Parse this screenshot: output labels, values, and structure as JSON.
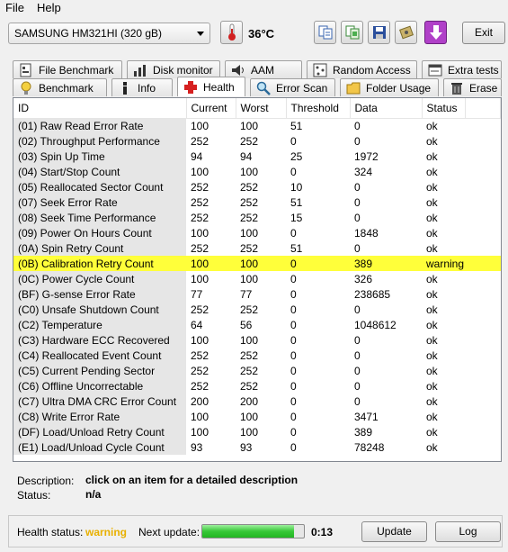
{
  "menu": {
    "file": "File",
    "help": "Help"
  },
  "toolbar": {
    "drive": "SAMSUNG HM321HI (320 gB)",
    "temperature": "36°C",
    "exit": "Exit"
  },
  "tabs_top": [
    {
      "label": "File Benchmark",
      "icon": "file-benchmark-icon"
    },
    {
      "label": "Disk monitor",
      "icon": "disk-monitor-icon"
    },
    {
      "label": "AAM",
      "icon": "speaker-icon"
    },
    {
      "label": "Random Access",
      "icon": "random-access-icon"
    },
    {
      "label": "Extra tests",
      "icon": "extra-tests-icon"
    }
  ],
  "tabs_bottom": [
    {
      "label": "Benchmark",
      "icon": "lightbulb-icon"
    },
    {
      "label": "Info",
      "icon": "info-icon"
    },
    {
      "label": "Health",
      "icon": "health-cross-icon"
    },
    {
      "label": "Error Scan",
      "icon": "magnifier-icon"
    },
    {
      "label": "Folder Usage",
      "icon": "folder-icon"
    },
    {
      "label": "Erase",
      "icon": "trash-icon"
    }
  ],
  "table": {
    "columns": [
      "ID",
      "Current",
      "Worst",
      "Threshold",
      "Data",
      "Status"
    ],
    "rows": [
      [
        "(01) Raw Read Error Rate",
        "100",
        "100",
        "51",
        "0",
        "ok"
      ],
      [
        "(02) Throughput Performance",
        "252",
        "252",
        "0",
        "0",
        "ok"
      ],
      [
        "(03) Spin Up Time",
        "94",
        "94",
        "25",
        "1972",
        "ok"
      ],
      [
        "(04) Start/Stop Count",
        "100",
        "100",
        "0",
        "324",
        "ok"
      ],
      [
        "(05) Reallocated Sector Count",
        "252",
        "252",
        "10",
        "0",
        "ok"
      ],
      [
        "(07) Seek Error Rate",
        "252",
        "252",
        "51",
        "0",
        "ok"
      ],
      [
        "(08) Seek Time Performance",
        "252",
        "252",
        "15",
        "0",
        "ok"
      ],
      [
        "(09) Power On Hours Count",
        "100",
        "100",
        "0",
        "1848",
        "ok"
      ],
      [
        "(0A) Spin Retry Count",
        "252",
        "252",
        "51",
        "0",
        "ok"
      ],
      [
        "(0B) Calibration Retry Count",
        "100",
        "100",
        "0",
        "389",
        "warning"
      ],
      [
        "(0C) Power Cycle Count",
        "100",
        "100",
        "0",
        "326",
        "ok"
      ],
      [
        "(BF) G-sense Error Rate",
        "77",
        "77",
        "0",
        "238685",
        "ok"
      ],
      [
        "(C0) Unsafe Shutdown Count",
        "252",
        "252",
        "0",
        "0",
        "ok"
      ],
      [
        "(C2) Temperature",
        "64",
        "56",
        "0",
        "1048612",
        "ok"
      ],
      [
        "(C3) Hardware ECC Recovered",
        "100",
        "100",
        "0",
        "0",
        "ok"
      ],
      [
        "(C4) Reallocated Event Count",
        "252",
        "252",
        "0",
        "0",
        "ok"
      ],
      [
        "(C5) Current Pending Sector",
        "252",
        "252",
        "0",
        "0",
        "ok"
      ],
      [
        "(C6) Offline Uncorrectable",
        "252",
        "252",
        "0",
        "0",
        "ok"
      ],
      [
        "(C7) Ultra DMA CRC Error Count",
        "200",
        "200",
        "0",
        "0",
        "ok"
      ],
      [
        "(C8) Write Error Rate",
        "100",
        "100",
        "0",
        "3471",
        "ok"
      ],
      [
        "(DF) Load/Unload Retry Count",
        "100",
        "100",
        "0",
        "389",
        "ok"
      ],
      [
        "(E1) Load/Unload Cycle Count",
        "93",
        "93",
        "0",
        "78248",
        "ok"
      ]
    ]
  },
  "description": {
    "label": "Description:",
    "value": "click on an item for a detailed description",
    "status_label": "Status:",
    "status_value": "n/a"
  },
  "footer": {
    "health_label": "Health status:",
    "health_value": "warning",
    "health_color": "#e8b000",
    "next_update_label": "Next update:",
    "progress_fraction": 0.9,
    "countdown": "0:13",
    "update_button": "Update",
    "log_button": "Log"
  },
  "colors": {
    "warning_row": "#ffff3a",
    "id_column": "#e6e6e6"
  }
}
